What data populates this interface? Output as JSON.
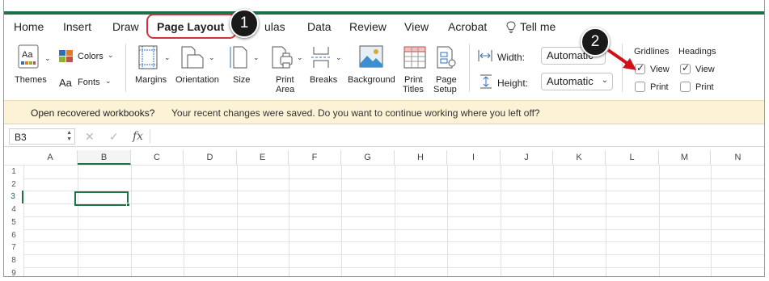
{
  "tabs": [
    "Home",
    "Insert",
    "Draw",
    "Page Layout",
    "Formulas",
    "Data",
    "Review",
    "View",
    "Acrobat",
    "Tell me"
  ],
  "tabs_visible": [
    "Home",
    "Insert",
    "Draw",
    "Page Layout",
    "ulas",
    "Data",
    "Review",
    "View",
    "Acrobat",
    "Tell me"
  ],
  "ribbon": {
    "themes": "Themes",
    "colors": "Colors",
    "fonts": "Fonts",
    "margins": "Margins",
    "orientation": "Orientation",
    "size": "Size",
    "print_area_1": "Print",
    "print_area_2": "Area",
    "breaks": "Breaks",
    "background": "Background",
    "print_titles_1": "Print",
    "print_titles_2": "Titles",
    "page_setup_1": "Page",
    "page_setup_2": "Setup",
    "width_label": "Width:",
    "width_value": "Automatic",
    "height_label": "Height:",
    "height_value": "Automatic",
    "gridlines": "Gridlines",
    "headings": "Headings",
    "gridlines_view": "View",
    "gridlines_print": "Print",
    "headings_view": "View",
    "headings_print": "Print",
    "gridlines_view_checked": true,
    "gridlines_print_checked": false,
    "headings_view_checked": true,
    "headings_print_checked": false
  },
  "infobar": {
    "title": "Open recovered workbooks?",
    "message": "Your recent changes were saved. Do you want to continue working where you left off?"
  },
  "formula_bar": {
    "name_box": "B3",
    "fx": "fx",
    "cancel": "✕",
    "enter": "✓"
  },
  "grid": {
    "columns": [
      "A",
      "B",
      "C",
      "D",
      "E",
      "F",
      "G",
      "H",
      "I",
      "J",
      "K",
      "L",
      "M",
      "N"
    ],
    "rows": [
      "1",
      "2",
      "3",
      "4",
      "5",
      "6",
      "7",
      "8",
      "9"
    ],
    "selected_cell": "B3"
  },
  "callouts": [
    "1",
    "2"
  ],
  "colors": {
    "excel_green": "#1e7145",
    "highlight_red": "#d0333a",
    "infobar_bg": "#fcf2d6"
  }
}
